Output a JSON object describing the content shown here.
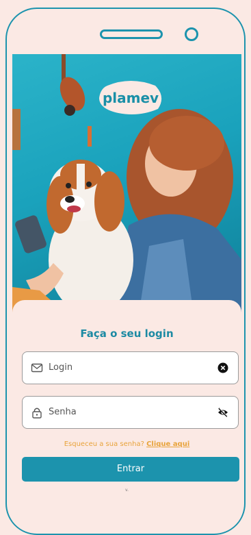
{
  "brand": {
    "logo_text": "plamev"
  },
  "login": {
    "title": "Faça o seu login",
    "login_placeholder": "Login",
    "password_placeholder": "Senha",
    "forgot_text": "Esqueceu a sua senha?",
    "forgot_link": "Clique aqui",
    "submit_label": "Entrar",
    "version": "v."
  },
  "colors": {
    "primary": "#1c93ad",
    "background": "#fbe9e4",
    "accent": "#e8a33a"
  },
  "icons": {
    "login_field": "mail-icon",
    "password_field": "lock-icon",
    "clear": "clear-icon",
    "toggle_password": "eye-off-icon"
  }
}
